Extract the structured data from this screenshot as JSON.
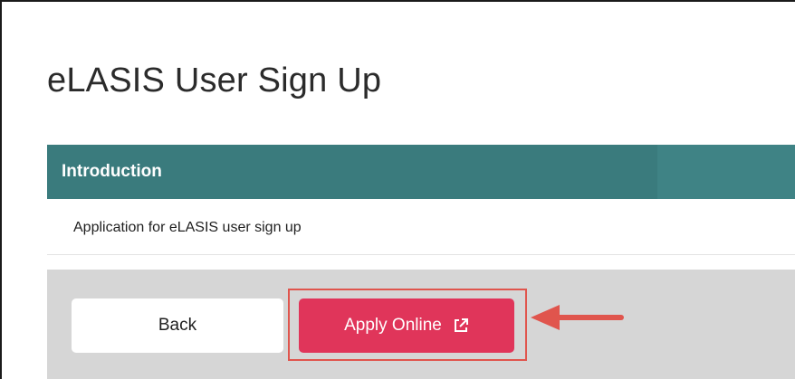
{
  "page": {
    "title": "eLASIS User Sign Up"
  },
  "introduction": {
    "heading": "Introduction",
    "text": "Application for eLASIS user sign up"
  },
  "actions": {
    "back_label": "Back",
    "apply_label": "Apply Online",
    "apply_icon": "external-link-icon"
  },
  "colors": {
    "header_bg": "#3a7b7d",
    "apply_bg": "#e0355a",
    "highlight": "#e0554d",
    "action_bar_bg": "#d6d6d6"
  }
}
